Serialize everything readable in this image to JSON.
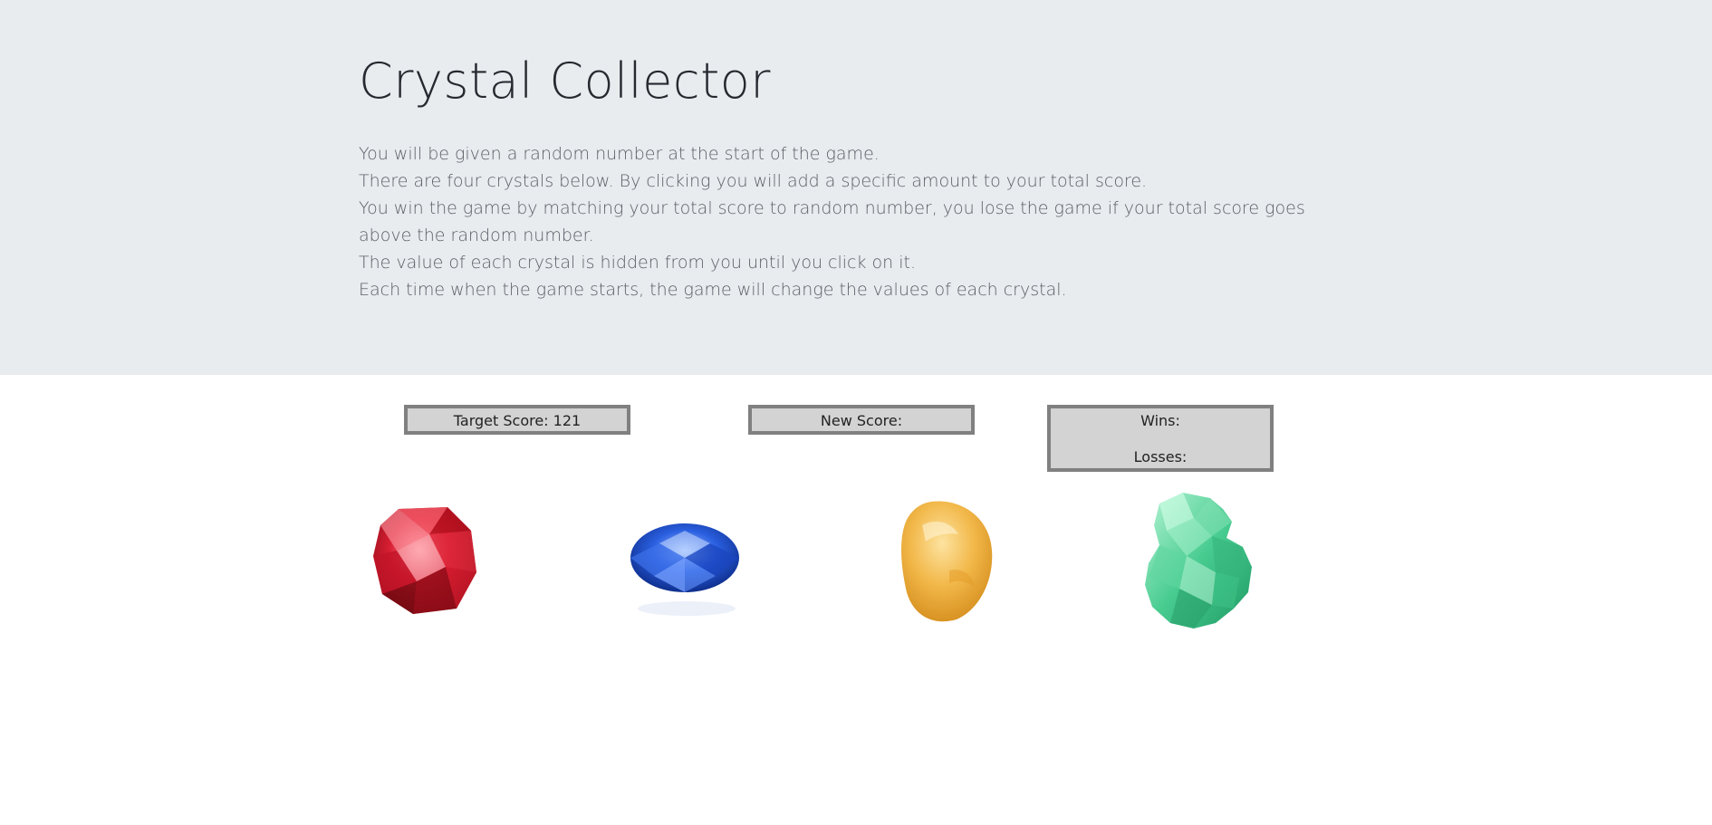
{
  "header": {
    "title": "Crystal Collector",
    "instructions": [
      "You will be given a random number at the start of the game.",
      "There are four crystals below. By clicking you will add a specific amount to your total score.",
      "You win the game by matching your total score to random number, you lose the game if your total score goes above the random number.",
      "The value of each crystal is hidden from you until you click on it.",
      "Each time when the game starts, the game will change the values of each crystal."
    ]
  },
  "scoreboard": {
    "target_label": "Target Score: 121",
    "new_score_label": "New Score:",
    "wins_label": "Wins:",
    "losses_label": "Losses:"
  },
  "crystals": [
    {
      "name": "red-crystal",
      "color": "#c8152a"
    },
    {
      "name": "blue-crystal",
      "color": "#1f4fd6"
    },
    {
      "name": "yellow-crystal",
      "color": "#f0b83c"
    },
    {
      "name": "green-crystal",
      "color": "#3fc98c"
    }
  ],
  "colors": {
    "header_background": "#e8ecef",
    "panel_background": "#d3d3d3",
    "panel_border": "#808080"
  }
}
